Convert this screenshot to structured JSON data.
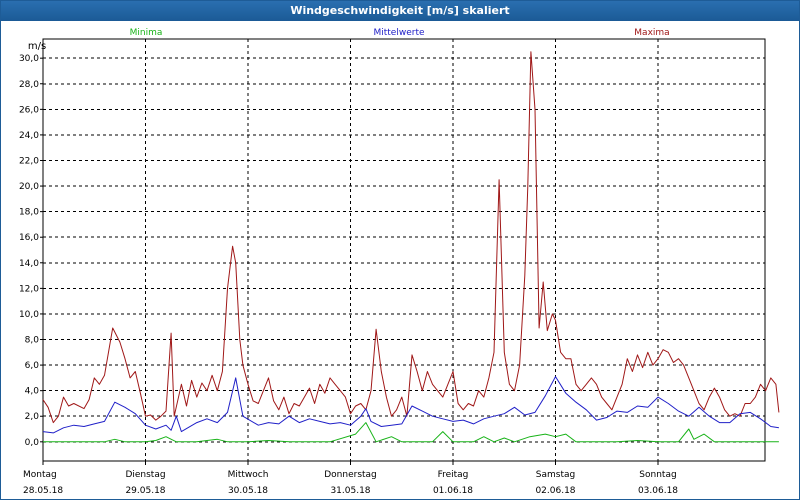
{
  "window": {
    "title": "Windgeschwindigkeit [m/s] skaliert"
  },
  "colors": {
    "min": "#18b318",
    "mean": "#2020c8",
    "max": "#a01818",
    "grid": "#000000",
    "frame": "#1e5c97"
  },
  "chart_data": {
    "type": "line",
    "title": "Windgeschwindigkeit [m/s] skaliert",
    "ylabel": "m/s",
    "xlabel": "",
    "ylim": [
      -1.5,
      31.5
    ],
    "yticks": [
      "0,0",
      "2,0",
      "4,0",
      "6,0",
      "8,0",
      "10,0",
      "12,0",
      "14,0",
      "16,0",
      "18,0",
      "20,0",
      "22,0",
      "24,0",
      "26,0",
      "28,0",
      "30,0"
    ],
    "ytick_values": [
      0,
      2,
      4,
      6,
      8,
      10,
      12,
      14,
      16,
      18,
      20,
      22,
      24,
      26,
      28,
      30
    ],
    "x_range": [
      0,
      7.18
    ],
    "grid": true,
    "legend_placement": "top",
    "days": [
      {
        "weekday": "Montag",
        "date": "28.05.18"
      },
      {
        "weekday": "Dienstag",
        "date": "29.05.18"
      },
      {
        "weekday": "Mittwoch",
        "date": "30.05.18"
      },
      {
        "weekday": "Donnerstag",
        "date": "31.05.18"
      },
      {
        "weekday": "Freitag",
        "date": "01.06.18"
      },
      {
        "weekday": "Samstag",
        "date": "02.06.18"
      },
      {
        "weekday": "Sonntag",
        "date": "03.06.18"
      }
    ],
    "series": [
      {
        "name": "Minima",
        "color": "#18b318",
        "points": [
          [
            0.0,
            0.0
          ],
          [
            0.3,
            0.0
          ],
          [
            0.6,
            0.0
          ],
          [
            0.7,
            0.2
          ],
          [
            0.8,
            0.0
          ],
          [
            1.0,
            0.0
          ],
          [
            1.1,
            0.1
          ],
          [
            1.2,
            0.4
          ],
          [
            1.3,
            0.0
          ],
          [
            1.5,
            0.0
          ],
          [
            1.7,
            0.2
          ],
          [
            1.8,
            0.0
          ],
          [
            2.0,
            0.0
          ],
          [
            2.2,
            0.1
          ],
          [
            2.4,
            0.0
          ],
          [
            2.8,
            0.0
          ],
          [
            3.05,
            0.6
          ],
          [
            3.15,
            1.5
          ],
          [
            3.25,
            0.0
          ],
          [
            3.4,
            0.4
          ],
          [
            3.5,
            0.0
          ],
          [
            3.8,
            0.0
          ],
          [
            3.9,
            0.8
          ],
          [
            4.0,
            0.0
          ],
          [
            4.2,
            0.0
          ],
          [
            4.3,
            0.4
          ],
          [
            4.4,
            0.0
          ],
          [
            4.5,
            0.3
          ],
          [
            4.6,
            0.0
          ],
          [
            4.75,
            0.4
          ],
          [
            4.9,
            0.6
          ],
          [
            5.0,
            0.4
          ],
          [
            5.1,
            0.6
          ],
          [
            5.2,
            0.0
          ],
          [
            5.6,
            0.0
          ],
          [
            5.8,
            0.1
          ],
          [
            6.0,
            0.0
          ],
          [
            6.2,
            0.0
          ],
          [
            6.3,
            1.0
          ],
          [
            6.35,
            0.2
          ],
          [
            6.45,
            0.6
          ],
          [
            6.55,
            0.0
          ],
          [
            7.18,
            0.0
          ]
        ]
      },
      {
        "name": "Mittelwerte",
        "color": "#2020c8",
        "points": [
          [
            0.0,
            0.8
          ],
          [
            0.1,
            0.7
          ],
          [
            0.2,
            1.1
          ],
          [
            0.3,
            1.3
          ],
          [
            0.4,
            1.2
          ],
          [
            0.5,
            1.4
          ],
          [
            0.6,
            1.6
          ],
          [
            0.7,
            3.1
          ],
          [
            0.8,
            2.7
          ],
          [
            0.9,
            2.2
          ],
          [
            1.0,
            1.3
          ],
          [
            1.1,
            1.0
          ],
          [
            1.2,
            1.3
          ],
          [
            1.25,
            0.9
          ],
          [
            1.3,
            2.0
          ],
          [
            1.35,
            0.8
          ],
          [
            1.5,
            1.5
          ],
          [
            1.6,
            1.8
          ],
          [
            1.7,
            1.5
          ],
          [
            1.8,
            2.3
          ],
          [
            1.88,
            5.0
          ],
          [
            1.95,
            2.0
          ],
          [
            2.1,
            1.3
          ],
          [
            2.2,
            1.5
          ],
          [
            2.3,
            1.4
          ],
          [
            2.4,
            2.0
          ],
          [
            2.5,
            1.5
          ],
          [
            2.6,
            1.8
          ],
          [
            2.7,
            1.6
          ],
          [
            2.8,
            1.4
          ],
          [
            2.9,
            1.5
          ],
          [
            3.0,
            1.3
          ],
          [
            3.1,
            2.0
          ],
          [
            3.15,
            2.6
          ],
          [
            3.2,
            1.6
          ],
          [
            3.3,
            1.2
          ],
          [
            3.4,
            1.3
          ],
          [
            3.5,
            1.4
          ],
          [
            3.6,
            2.8
          ],
          [
            3.7,
            2.4
          ],
          [
            3.8,
            2.0
          ],
          [
            3.9,
            1.8
          ],
          [
            4.0,
            1.6
          ],
          [
            4.1,
            1.7
          ],
          [
            4.2,
            1.4
          ],
          [
            4.3,
            1.8
          ],
          [
            4.4,
            2.0
          ],
          [
            4.5,
            2.2
          ],
          [
            4.6,
            2.7
          ],
          [
            4.7,
            2.1
          ],
          [
            4.8,
            2.3
          ],
          [
            4.9,
            3.6
          ],
          [
            5.0,
            5.1
          ],
          [
            5.1,
            3.8
          ],
          [
            5.2,
            3.1
          ],
          [
            5.3,
            2.5
          ],
          [
            5.4,
            1.7
          ],
          [
            5.5,
            1.9
          ],
          [
            5.6,
            2.4
          ],
          [
            5.7,
            2.3
          ],
          [
            5.8,
            2.8
          ],
          [
            5.9,
            2.7
          ],
          [
            6.0,
            3.5
          ],
          [
            6.1,
            3.0
          ],
          [
            6.2,
            2.4
          ],
          [
            6.3,
            2.0
          ],
          [
            6.4,
            2.7
          ],
          [
            6.5,
            2.0
          ],
          [
            6.6,
            1.5
          ],
          [
            6.7,
            1.5
          ],
          [
            6.8,
            2.2
          ],
          [
            6.9,
            2.3
          ],
          [
            7.0,
            1.8
          ],
          [
            7.1,
            1.2
          ],
          [
            7.18,
            1.1
          ]
        ]
      },
      {
        "name": "Maxima",
        "color": "#a01818",
        "points": [
          [
            0.0,
            3.3
          ],
          [
            0.05,
            2.7
          ],
          [
            0.1,
            1.5
          ],
          [
            0.15,
            2.0
          ],
          [
            0.2,
            3.5
          ],
          [
            0.25,
            2.8
          ],
          [
            0.3,
            3.0
          ],
          [
            0.4,
            2.6
          ],
          [
            0.45,
            3.3
          ],
          [
            0.5,
            5.0
          ],
          [
            0.55,
            4.5
          ],
          [
            0.6,
            5.2
          ],
          [
            0.68,
            8.9
          ],
          [
            0.75,
            7.8
          ],
          [
            0.8,
            6.5
          ],
          [
            0.85,
            5.0
          ],
          [
            0.9,
            5.5
          ],
          [
            0.95,
            3.8
          ],
          [
            1.0,
            2.0
          ],
          [
            1.05,
            2.1
          ],
          [
            1.1,
            1.7
          ],
          [
            1.15,
            2.0
          ],
          [
            1.2,
            2.4
          ],
          [
            1.25,
            8.5
          ],
          [
            1.28,
            2.0
          ],
          [
            1.35,
            4.5
          ],
          [
            1.4,
            2.8
          ],
          [
            1.45,
            4.8
          ],
          [
            1.5,
            3.5
          ],
          [
            1.55,
            4.6
          ],
          [
            1.6,
            4.0
          ],
          [
            1.65,
            5.2
          ],
          [
            1.7,
            4.0
          ],
          [
            1.75,
            5.5
          ],
          [
            1.8,
            12.0
          ],
          [
            1.85,
            15.3
          ],
          [
            1.88,
            14.0
          ],
          [
            1.92,
            8.0
          ],
          [
            1.95,
            6.0
          ],
          [
            2.0,
            4.5
          ],
          [
            2.05,
            3.2
          ],
          [
            2.1,
            3.0
          ],
          [
            2.15,
            4.0
          ],
          [
            2.2,
            5.0
          ],
          [
            2.25,
            3.2
          ],
          [
            2.3,
            2.5
          ],
          [
            2.35,
            3.5
          ],
          [
            2.4,
            2.2
          ],
          [
            2.45,
            3.0
          ],
          [
            2.5,
            2.8
          ],
          [
            2.55,
            3.5
          ],
          [
            2.6,
            4.2
          ],
          [
            2.65,
            3.0
          ],
          [
            2.7,
            4.5
          ],
          [
            2.75,
            3.8
          ],
          [
            2.8,
            5.0
          ],
          [
            2.85,
            4.5
          ],
          [
            2.9,
            4.0
          ],
          [
            2.95,
            3.5
          ],
          [
            3.0,
            2.2
          ],
          [
            3.05,
            2.8
          ],
          [
            3.1,
            3.0
          ],
          [
            3.15,
            2.5
          ],
          [
            3.2,
            4.0
          ],
          [
            3.25,
            8.8
          ],
          [
            3.3,
            5.5
          ],
          [
            3.35,
            3.5
          ],
          [
            3.4,
            2.0
          ],
          [
            3.45,
            2.5
          ],
          [
            3.5,
            3.5
          ],
          [
            3.55,
            2.0
          ],
          [
            3.6,
            6.8
          ],
          [
            3.65,
            5.5
          ],
          [
            3.7,
            4.0
          ],
          [
            3.75,
            5.5
          ],
          [
            3.8,
            4.5
          ],
          [
            3.85,
            4.0
          ],
          [
            3.9,
            3.5
          ],
          [
            3.95,
            4.5
          ],
          [
            4.0,
            5.5
          ],
          [
            4.05,
            3.0
          ],
          [
            4.1,
            2.5
          ],
          [
            4.15,
            3.0
          ],
          [
            4.2,
            2.8
          ],
          [
            4.25,
            4.0
          ],
          [
            4.3,
            3.5
          ],
          [
            4.35,
            5.0
          ],
          [
            4.4,
            7.0
          ],
          [
            4.45,
            20.5
          ],
          [
            4.5,
            7.0
          ],
          [
            4.55,
            4.5
          ],
          [
            4.6,
            4.0
          ],
          [
            4.65,
            6.0
          ],
          [
            4.7,
            13.0
          ],
          [
            4.73,
            20.0
          ],
          [
            4.76,
            30.5
          ],
          [
            4.8,
            26.0
          ],
          [
            4.84,
            8.9
          ],
          [
            4.88,
            12.5
          ],
          [
            4.92,
            8.7
          ],
          [
            4.97,
            10.0
          ],
          [
            5.0,
            9.5
          ],
          [
            5.05,
            7.0
          ],
          [
            5.1,
            6.5
          ],
          [
            5.15,
            6.5
          ],
          [
            5.2,
            4.5
          ],
          [
            5.25,
            4.0
          ],
          [
            5.3,
            4.5
          ],
          [
            5.35,
            5.0
          ],
          [
            5.4,
            4.5
          ],
          [
            5.45,
            3.5
          ],
          [
            5.5,
            3.0
          ],
          [
            5.55,
            2.5
          ],
          [
            5.6,
            3.5
          ],
          [
            5.65,
            4.5
          ],
          [
            5.7,
            6.5
          ],
          [
            5.75,
            5.5
          ],
          [
            5.8,
            6.8
          ],
          [
            5.85,
            5.8
          ],
          [
            5.9,
            7.0
          ],
          [
            5.95,
            6.0
          ],
          [
            6.0,
            6.5
          ],
          [
            6.05,
            7.2
          ],
          [
            6.1,
            7.0
          ],
          [
            6.15,
            6.2
          ],
          [
            6.2,
            6.5
          ],
          [
            6.25,
            6.0
          ],
          [
            6.3,
            5.0
          ],
          [
            6.35,
            4.0
          ],
          [
            6.4,
            3.0
          ],
          [
            6.45,
            2.5
          ],
          [
            6.5,
            3.5
          ],
          [
            6.55,
            4.2
          ],
          [
            6.6,
            3.5
          ],
          [
            6.65,
            2.5
          ],
          [
            6.7,
            2.0
          ],
          [
            6.75,
            2.2
          ],
          [
            6.8,
            2.0
          ],
          [
            6.85,
            3.0
          ],
          [
            6.9,
            3.0
          ],
          [
            6.95,
            3.5
          ],
          [
            7.0,
            4.5
          ],
          [
            7.05,
            4.0
          ],
          [
            7.1,
            5.0
          ],
          [
            7.15,
            4.5
          ],
          [
            7.18,
            2.3
          ]
        ]
      }
    ]
  }
}
